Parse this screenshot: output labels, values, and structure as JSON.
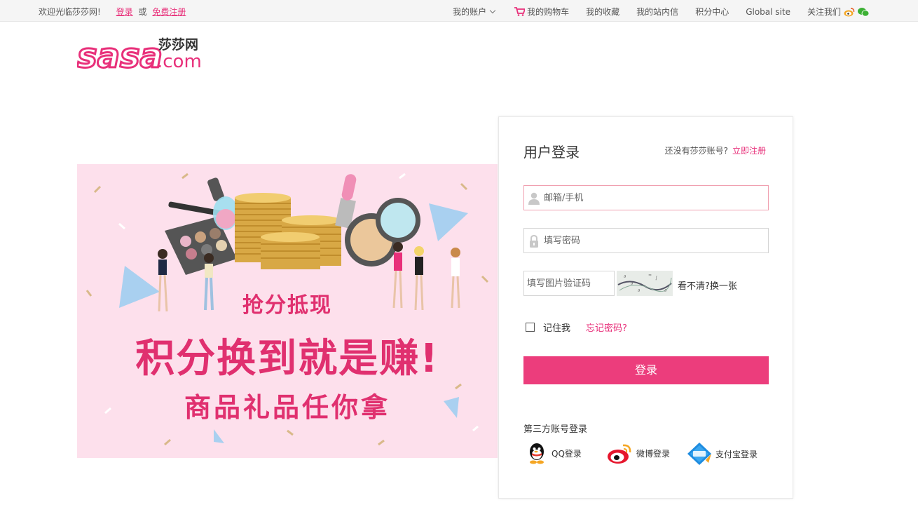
{
  "topbar": {
    "welcome": "欢迎光临莎莎网!",
    "login_link": "登录",
    "or_text": "或",
    "register_link": "免费注册",
    "nav": {
      "account": "我的账户",
      "cart": "我的购物车",
      "favorites": "我的收藏",
      "messages": "我的站内信",
      "points": "积分中心",
      "global": "Global site",
      "follow": "关注我们"
    }
  },
  "logo": {
    "text_main": "sasa",
    "text_dotcom": ".com",
    "text_cn": "莎莎网"
  },
  "banner": {
    "subtitle_top": "抢分抵现",
    "headline": "积分换到就是赚!",
    "subtitle_bottom": "商品礼品任你拿"
  },
  "login": {
    "title": "用户登录",
    "no_account_text": "还没有莎莎账号?",
    "register_now": "立即注册",
    "username_placeholder": "邮箱/手机",
    "password_placeholder": "填写密码",
    "captcha_placeholder": "填写图片验证码",
    "captcha_refresh": "看不清?换一张",
    "remember_me": "记住我",
    "forgot_password": "忘记密码?",
    "submit": "登录",
    "third_party_title": "第三方账号登录",
    "third_party": [
      {
        "label": "QQ登录",
        "icon": "qq-icon"
      },
      {
        "label": "微博登录",
        "icon": "weibo-icon"
      },
      {
        "label": "支付宝登录",
        "icon": "alipay-icon"
      }
    ]
  },
  "colors": {
    "brand_pink": "#ec3d7c",
    "link_pink": "#e8307a",
    "banner_bg": "#fde0ec"
  }
}
